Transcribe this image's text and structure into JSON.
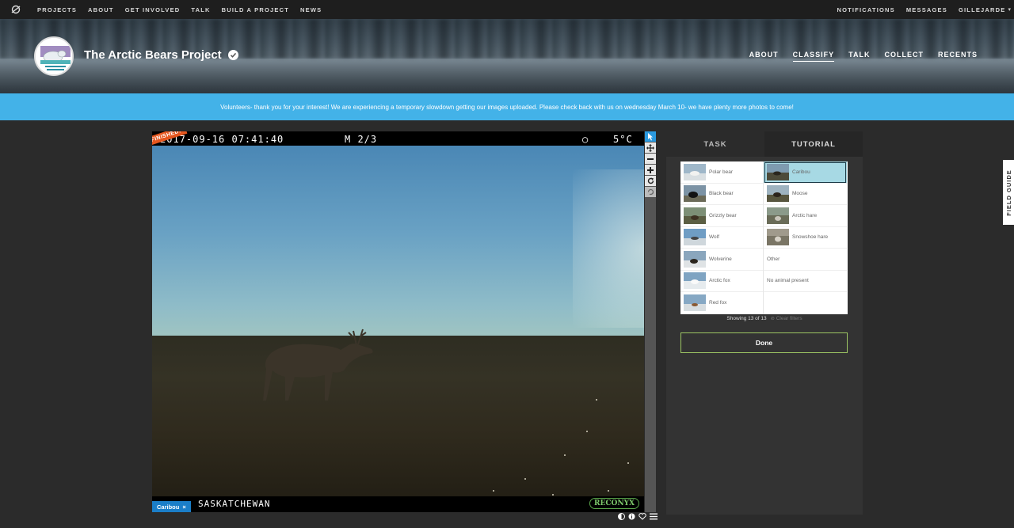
{
  "topbar": {
    "nav": [
      "PROJECTS",
      "ABOUT",
      "GET INVOLVED",
      "TALK",
      "BUILD A PROJECT",
      "NEWS"
    ],
    "right": [
      "NOTIFICATIONS",
      "MESSAGES",
      "GILLEJARDE"
    ]
  },
  "project": {
    "title": "The Arctic Bears Project",
    "nav": [
      "ABOUT",
      "CLASSIFY",
      "TALK",
      "COLLECT",
      "RECENTS"
    ],
    "active_nav": "CLASSIFY"
  },
  "announcement": "Volunteers- thank you for your interest! We are experiencing a temporary slowdown getting our images uploaded. Please check back with us on wednesday March 10- we have plenty more photos to come!",
  "subject": {
    "timestamp": "2017-09-16 07:41:40",
    "mode": "M 2/3",
    "moon": "○",
    "temperature": "5°C",
    "location": "SASKATCHEWAN",
    "camera_brand": "RECONYX",
    "finished_label": "FINISHED!",
    "tag_label": "Caribou",
    "tag_close": "×"
  },
  "task": {
    "tabs": [
      "TASK",
      "TUTORIAL"
    ],
    "left_choices": [
      "Polar bear",
      "Black bear",
      "Grizzly bear",
      "Wolf",
      "Wolverine",
      "Arctic fox",
      "Red fox"
    ],
    "right_choices": [
      "Caribou",
      "Moose",
      "Arctic hare",
      "Snowshoe hare",
      "Other",
      "No animal present"
    ],
    "selected": "Caribou",
    "showing": "Showing 13 of 13",
    "clear_filters": "Clear filters",
    "done_label": "Done"
  },
  "field_guide": "FIELD GUIDE",
  "colors": {
    "accent_blue": "#43b2e8",
    "done_border": "#9cc563",
    "finished_orange": "#e5561e",
    "selected_choice": "#a7d9e4"
  }
}
